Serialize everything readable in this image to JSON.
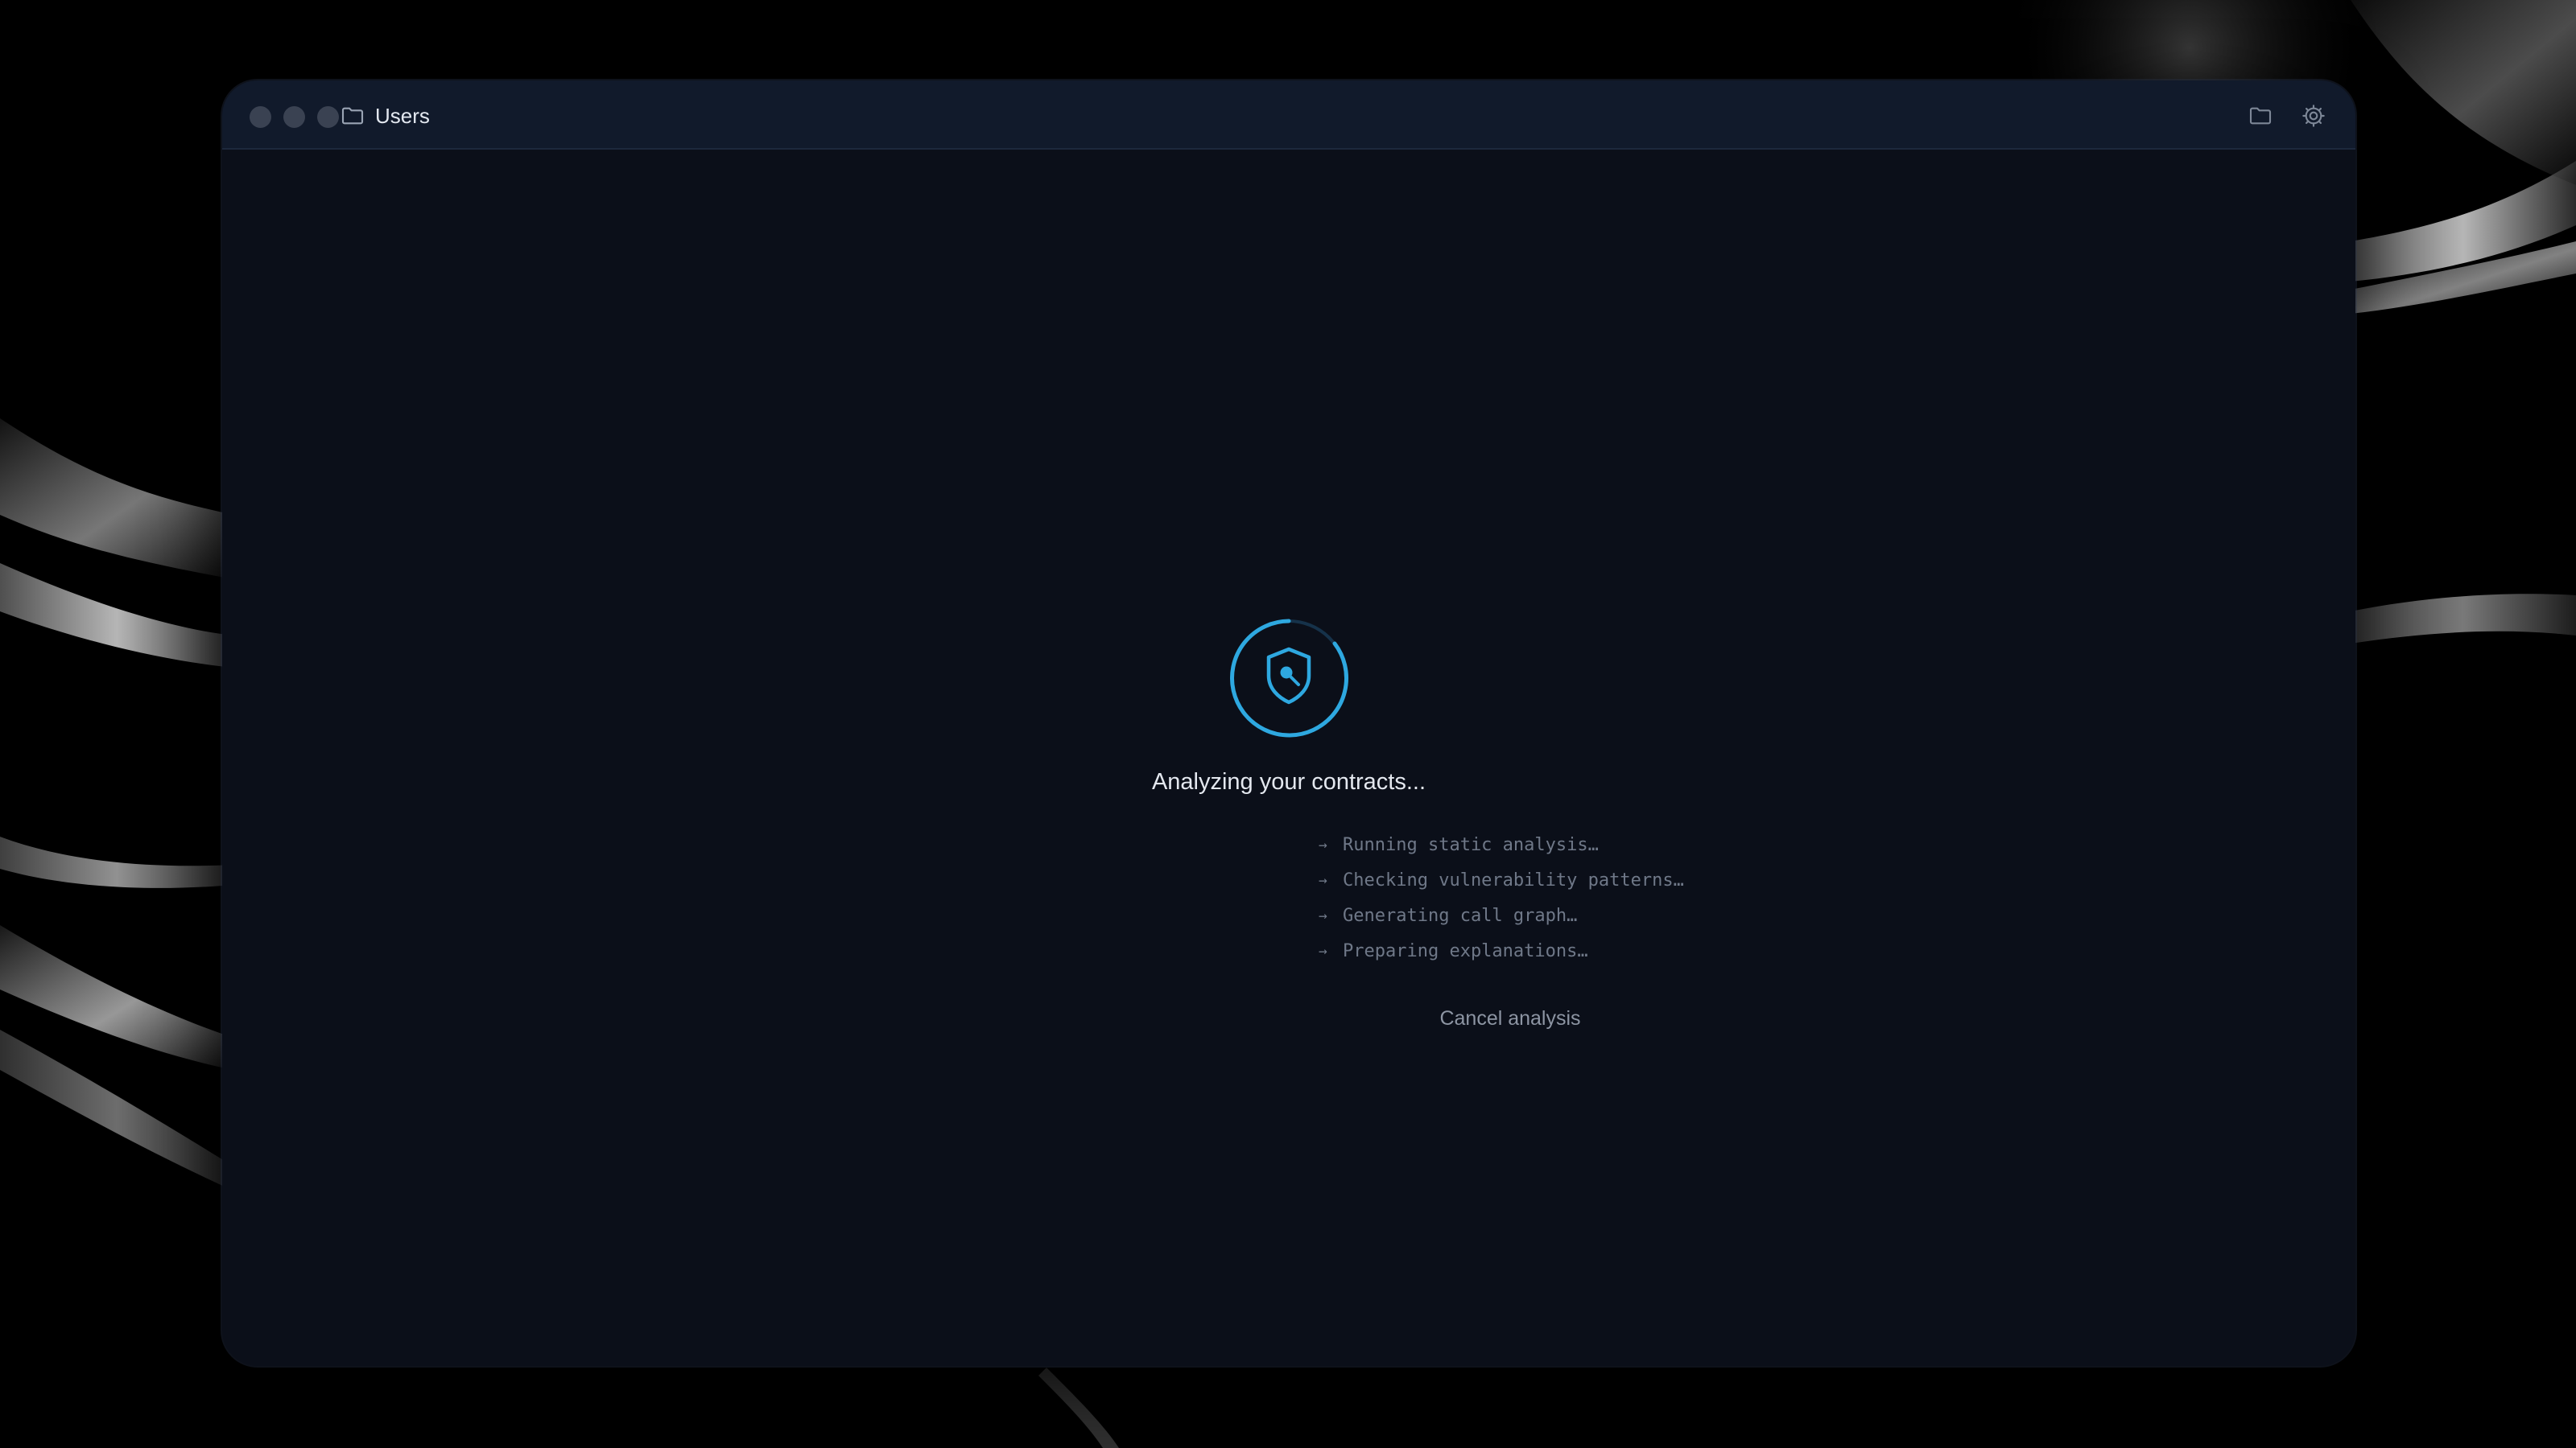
{
  "window": {
    "breadcrumb_icon": "folder-icon",
    "breadcrumb_label": "Users",
    "titlebar_actions": [
      {
        "icon": "folder-icon"
      },
      {
        "icon": "gear-icon"
      }
    ]
  },
  "analysis": {
    "spinner_icon": "shield-search-icon",
    "title": "Analyzing your contracts...",
    "steps": [
      {
        "arrow": "→",
        "text": "Running static analysis…"
      },
      {
        "arrow": "→",
        "text": "Checking vulnerability patterns…"
      },
      {
        "arrow": "→",
        "text": "Generating call graph…"
      },
      {
        "arrow": "→",
        "text": "Preparing explanations…"
      }
    ],
    "cancel_label": "Cancel analysis"
  },
  "colors": {
    "accent": "#2ea8e0",
    "window_background": "#0b0f19",
    "titlebar_background": "#111a2b",
    "muted_text": "#6f7888"
  }
}
